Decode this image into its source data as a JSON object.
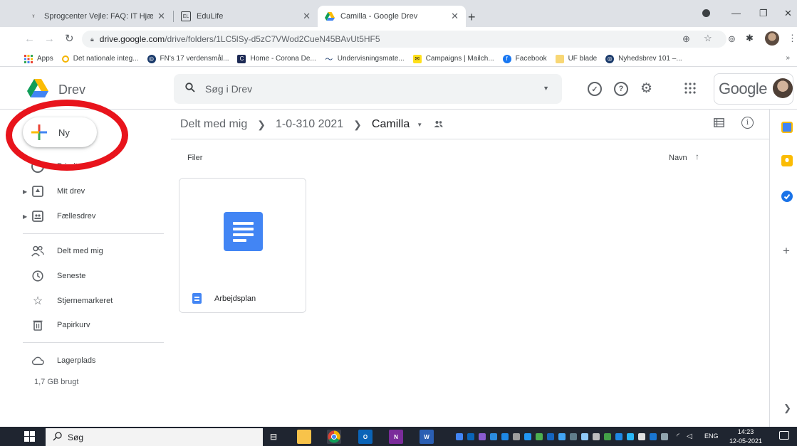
{
  "browser": {
    "tabs": [
      {
        "title": "Sprogcenter Vejle: FAQ: IT Hjælp"
      },
      {
        "title": "EduLife"
      },
      {
        "title": "Camilla - Google Drev",
        "active": true
      }
    ],
    "url_host": "drive.google.com",
    "url_path": "/drive/folders/1LC5lSy-d5zC7VWod2CueN45BAvUt5HF5",
    "bookmarks": [
      {
        "label": "Apps",
        "icon": "apps-grid-icon"
      },
      {
        "label": "Det nationale integ...",
        "icon": "globe-icon"
      },
      {
        "label": "FN's 17 verdensmål...",
        "icon": "globe-icon"
      },
      {
        "label": "Home - Corona De...",
        "icon": "c-icon"
      },
      {
        "label": "Undervisningsmate...",
        "icon": "wave-icon"
      },
      {
        "label": "Campaigns | Mailch...",
        "icon": "mailchimp-icon"
      },
      {
        "label": "Facebook",
        "icon": "facebook-icon"
      },
      {
        "label": "UF blade",
        "icon": "folder-icon"
      },
      {
        "label": "Nyhedsbrev 101 –...",
        "icon": "globe-icon"
      }
    ],
    "bookmarks_more": "»"
  },
  "drive": {
    "logo_text": "Drev",
    "search_placeholder": "Søg i Drev",
    "google_label": "Google",
    "new_button": "Ny",
    "nav": [
      {
        "label": "Prioritet",
        "icon": "priority-icon"
      },
      {
        "label": "Mit drev",
        "icon": "my-drive-icon",
        "expandable": true
      },
      {
        "label": "Fællesdrev",
        "icon": "shared-drives-icon",
        "expandable": true
      },
      {
        "label": "Delt med mig",
        "icon": "people-icon"
      },
      {
        "label": "Seneste",
        "icon": "clock-icon"
      },
      {
        "label": "Stjernemarkeret",
        "icon": "star-icon"
      },
      {
        "label": "Papirkurv",
        "icon": "trash-icon"
      },
      {
        "label": "Lagerplads",
        "icon": "cloud-icon"
      }
    ],
    "storage_used": "1,7 GB brugt",
    "breadcrumb": [
      "Delt med mig",
      "1-0-310 2021",
      "Camilla"
    ],
    "section_label": "Filer",
    "sort_label": "Navn",
    "files": [
      {
        "name": "Arbejdsplan",
        "type": "google-doc"
      }
    ]
  },
  "taskbar": {
    "search_label": "Søg",
    "language": "ENG",
    "time": "14:23",
    "date": "12-05-2021"
  },
  "colors": {
    "highlight_ring": "#e8141c",
    "docs_blue": "#4285f4"
  }
}
